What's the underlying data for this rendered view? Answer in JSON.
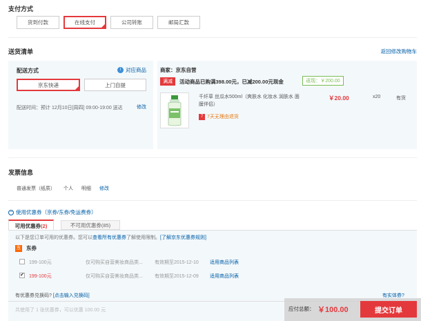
{
  "payment": {
    "title": "支付方式",
    "options": [
      "货到付款",
      "在线支付",
      "公司转账",
      "邮局汇款"
    ]
  },
  "delivery": {
    "title": "送货清单",
    "back_link": "返回修改购物车",
    "method_title": "配送方式",
    "items_link": "对应商品",
    "options": [
      "京东快递",
      "上门自提"
    ],
    "time_label": "配送时间：预计 12月10日[周四] 09:00-19:00 送达",
    "edit_label": "修改"
  },
  "seller": {
    "label": "商家：京东自营",
    "promo_tag": "满减",
    "promo_text": "活动商品已购满398.00元，已减200.00元现金",
    "saved_badge": "返现：￥200.00",
    "product_name": "千纤草 丝瓜水500ml（爽肤水 化妆水 润肤水 面膜伴侣）",
    "price": "￥20.00",
    "qty": "x20",
    "stock": "有货",
    "return_note": "7天无理由退货"
  },
  "invoice": {
    "title": "发票信息",
    "type": "普通发票（纸质）",
    "personal": "个人",
    "detail": "明细",
    "edit_label": "修改"
  },
  "coupon": {
    "toggle_label": "使用优惠券（京券/东券/免运费券）",
    "tab_available": "可用优惠券",
    "tab_available_count": "(2)",
    "tab_unavailable": "不可用优惠券(85)",
    "hint_prefix": "以下是您订单可用的优惠券。您可以",
    "hint_link1": "查看所有优惠券",
    "hint_mid": "了解使用限制。",
    "hint_link2": "[了解京东优惠券规则]",
    "group_icon": "东",
    "group_label": "东券",
    "rows": [
      {
        "amount": "199-100元",
        "desc": "仅可购买自营美妆商品类...",
        "expiry": "有效期至2015-12-10",
        "link": "适用商品列表",
        "checked": false
      },
      {
        "amount": "199-100元",
        "desc": "仅可购买自营美妆商品类...",
        "expiry": "有效期至2015-12-09",
        "link": "适用商品列表",
        "checked": true
      }
    ],
    "redeem_prefix": "有优惠券兑换码?",
    "redeem_link": "[点击输入兑换码]",
    "real_coupon": "有实体券?",
    "summary": "共使用了 1 张优惠券，可以优惠 100.00 元"
  },
  "footer": {
    "payable_label": "应付总额：",
    "payable_value": "￥100.00",
    "submit_label": "提交订单"
  },
  "colors": {
    "accent": "#e4393c",
    "link": "#005ea7",
    "panel": "#f3f8fb"
  }
}
